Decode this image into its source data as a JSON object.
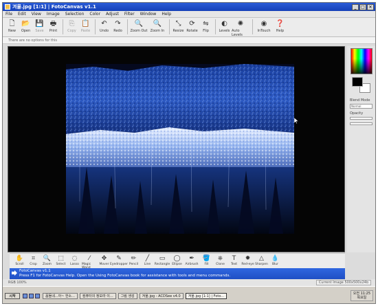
{
  "window": {
    "title": "겨울.jpg [1:1] | FotoCanvas v1.1",
    "controls": [
      "_",
      "□",
      "✕"
    ]
  },
  "menu": [
    "File",
    "Edit",
    "View",
    "Image",
    "Selection",
    "Color",
    "Adjust",
    "Filter",
    "Window",
    "Help"
  ],
  "toolbar": [
    {
      "label": "New",
      "icon": "new-file-icon",
      "glyph": "🗋",
      "disabled": false
    },
    {
      "label": "Open",
      "icon": "open-folder-icon",
      "glyph": "📂",
      "disabled": false
    },
    {
      "label": "Save",
      "icon": "save-icon",
      "glyph": "💾",
      "disabled": true
    },
    {
      "label": "Print",
      "icon": "print-icon",
      "glyph": "🖶",
      "disabled": false
    },
    {
      "label": "Copy",
      "icon": "copy-icon",
      "glyph": "⎘",
      "disabled": true
    },
    {
      "label": "Paste",
      "icon": "paste-icon",
      "glyph": "📋",
      "disabled": true
    },
    {
      "label": "Undo",
      "icon": "undo-icon",
      "glyph": "↶",
      "disabled": false
    },
    {
      "label": "Redo",
      "icon": "redo-icon",
      "glyph": "↷",
      "disabled": false
    },
    {
      "label": "Zoom Out",
      "icon": "zoom-out-icon",
      "glyph": "🔍",
      "disabled": false
    },
    {
      "label": "Zoom In",
      "icon": "zoom-in-icon",
      "glyph": "🔍",
      "disabled": false
    },
    {
      "label": "Resize",
      "icon": "resize-icon",
      "glyph": "⤡",
      "disabled": false
    },
    {
      "label": "Rotate",
      "icon": "rotate-icon",
      "glyph": "⟳",
      "disabled": false
    },
    {
      "label": "Flip",
      "icon": "flip-icon",
      "glyph": "⇋",
      "disabled": false
    },
    {
      "label": "Levels",
      "icon": "levels-icon",
      "glyph": "◐",
      "disabled": false
    },
    {
      "label": "Auto Levels",
      "icon": "auto-levels-icon",
      "glyph": "✺",
      "disabled": false
    },
    {
      "label": "InTouch",
      "icon": "intouch-icon",
      "glyph": "◉",
      "disabled": false
    },
    {
      "label": "Help",
      "icon": "help-icon",
      "glyph": "❓",
      "disabled": false
    }
  ],
  "options_bar": "There are no options for this",
  "right_panel": {
    "blend_mode_label": "Blend Mode",
    "blend_mode_value": "Normal",
    "opacity_label": "Opacity"
  },
  "tools": [
    {
      "label": "Scroll",
      "icon": "hand-icon",
      "glyph": "✋"
    },
    {
      "label": "Crop",
      "icon": "crop-icon",
      "glyph": "⌗"
    },
    {
      "label": "Zoom",
      "icon": "magnifier-icon",
      "glyph": "🔍"
    },
    {
      "label": "Select",
      "icon": "select-rect-icon",
      "glyph": "⬚"
    },
    {
      "label": "Lasso",
      "icon": "lasso-icon",
      "glyph": "◌"
    },
    {
      "label": "Magic Wand",
      "icon": "magic-wand-icon",
      "glyph": "⁄"
    },
    {
      "label": "Mover",
      "icon": "move-icon",
      "glyph": "✥"
    },
    {
      "label": "Eyedropper",
      "icon": "eyedropper-icon",
      "glyph": "✎"
    },
    {
      "label": "Pencil",
      "icon": "pencil-icon",
      "glyph": "✏"
    },
    {
      "label": "Line",
      "icon": "line-icon",
      "glyph": "╱"
    },
    {
      "label": "Rectangle",
      "icon": "rectangle-icon",
      "glyph": "▭"
    },
    {
      "label": "Ellipse",
      "icon": "ellipse-icon",
      "glyph": "◯"
    },
    {
      "label": "Airbrush",
      "icon": "airbrush-icon",
      "glyph": "✒"
    },
    {
      "label": "Fill",
      "icon": "fill-bucket-icon",
      "glyph": "🪣"
    },
    {
      "label": "Clone",
      "icon": "clone-stamp-icon",
      "glyph": "⎈"
    },
    {
      "label": "Text",
      "icon": "text-tool-icon",
      "glyph": "T"
    },
    {
      "label": "Red-eye",
      "icon": "red-eye-icon",
      "glyph": "✹"
    },
    {
      "label": "Sharpen",
      "icon": "sharpen-icon",
      "glyph": "△"
    },
    {
      "label": "Blur",
      "icon": "blur-icon",
      "glyph": "💧"
    }
  ],
  "help": {
    "title": "FotoCanvas v1.1",
    "text": "Press F1 for FotoCanvas Help.  Open the Using FotoCanvas book for assistance with tools and menu commands."
  },
  "status": {
    "left": "RGB 100%",
    "image_size": "Current Image   500x500x24b"
  },
  "taskbar": {
    "start": "시작",
    "tasks": [
      "꼼돌네...아~ 한소...",
      "컴퓨터의 정보라 이...",
      "그림 생성",
      "겨울.jpg - ACDSee v4.0",
      "겨울.jpg [1:1] | Foto..."
    ],
    "active_task": 4,
    "tray_time": "오전 11:25",
    "tray_day": "목요일"
  },
  "colors": {
    "accent": "#1f4fc4",
    "primary_swatch": "#000000",
    "secondary_swatch": "#ffffff"
  }
}
